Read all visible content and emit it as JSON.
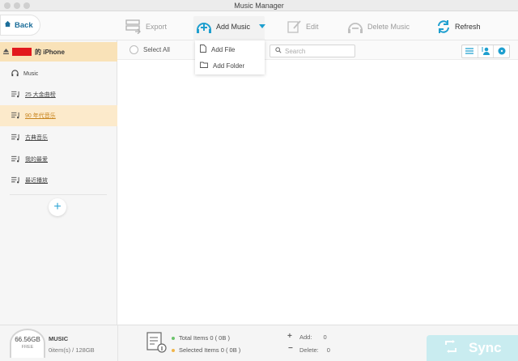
{
  "window": {
    "title": "Music Manager"
  },
  "toolbar": {
    "back_label": "Back",
    "export_label": "Export",
    "add_music_label": "Add Music",
    "edit_label": "Edit",
    "delete_music_label": "Delete Music",
    "refresh_label": "Refresh"
  },
  "add_menu": {
    "add_file": "Add File",
    "add_folder": "Add Folder"
  },
  "device": {
    "name_suffix": "的 iPhone"
  },
  "sidebar": {
    "items": [
      {
        "label": "Music",
        "icon": "headphones-icon"
      },
      {
        "label": "25 大金曲榜",
        "icon": "playlist-icon"
      },
      {
        "label": "90 年代音乐",
        "icon": "playlist-icon",
        "selected": true
      },
      {
        "label": "古典音乐",
        "icon": "playlist-icon"
      },
      {
        "label": "我的最爱",
        "icon": "playlist-icon"
      },
      {
        "label": "最近播放",
        "icon": "playlist-icon"
      }
    ]
  },
  "content": {
    "select_all": "Select All",
    "search_placeholder": "Search"
  },
  "storage": {
    "free": "66.56GB",
    "free_label": "FREE",
    "media_type": "MUSIC",
    "usage": "0item(s) / 128GB"
  },
  "summary": {
    "total": "Total Items 0 ( 0B )",
    "selected": "Selected Items 0 ( 0B )",
    "add_label": "Add:",
    "add_value": "0",
    "delete_label": "Delete:",
    "delete_value": "0",
    "total_dot_color": "#6cc36c",
    "selected_dot_color": "#f0b54a"
  },
  "sync": {
    "label": "Sync"
  },
  "colors": {
    "accent": "#33a7d6",
    "selected_bg": "#fceacb",
    "device_bg": "#f9e2b8",
    "redaction": "#e2191d"
  }
}
